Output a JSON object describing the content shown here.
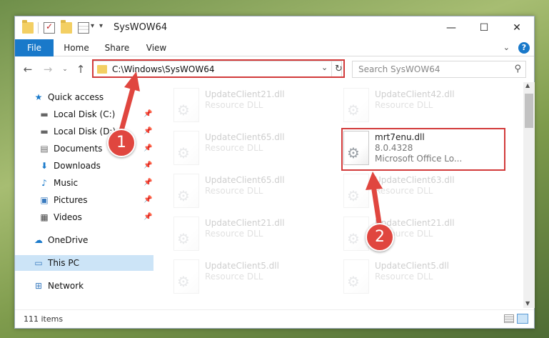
{
  "window": {
    "title": "SysWOW64",
    "controls": {
      "minimize": "—",
      "maximize": "☐",
      "close": "✕"
    }
  },
  "ribbon": {
    "tabs": [
      "File",
      "Home",
      "Share",
      "View"
    ],
    "help": "?"
  },
  "nav": {
    "address": "C:\\Windows\\SysWOW64",
    "search_placeholder": "Search SysWOW64"
  },
  "sidebar": {
    "items": [
      {
        "label": "Quick access",
        "icon": "star-icon",
        "pinned": false
      },
      {
        "label": "Local Disk (C:)",
        "icon": "drive-icon",
        "pinned": true
      },
      {
        "label": "Local Disk (D:)",
        "icon": "drive-icon",
        "pinned": true
      },
      {
        "label": "Documents",
        "icon": "documents-icon",
        "pinned": true
      },
      {
        "label": "Downloads",
        "icon": "download-icon",
        "pinned": true
      },
      {
        "label": "Music",
        "icon": "music-icon",
        "pinned": true
      },
      {
        "label": "Pictures",
        "icon": "pictures-icon",
        "pinned": true
      },
      {
        "label": "Videos",
        "icon": "videos-icon",
        "pinned": true
      },
      {
        "label": "OneDrive",
        "icon": "cloud-icon",
        "pinned": false
      },
      {
        "label": "This PC",
        "icon": "computer-icon",
        "pinned": false,
        "selected": true
      },
      {
        "label": "Network",
        "icon": "network-icon",
        "pinned": false
      }
    ]
  },
  "files": [
    {
      "name": "UpdateClient21.dll",
      "type": "Resource DLL",
      "desc": ""
    },
    {
      "name": "UpdateClient42.dll",
      "type": "Resource DLL",
      "desc": ""
    },
    {
      "name": "UpdateClient65.dll",
      "type": "Resource DLL",
      "desc": ""
    },
    {
      "name": "mrt7enu.dll",
      "type": "8.0.4328",
      "desc": "Microsoft Office Lo...",
      "highlighted": true
    },
    {
      "name": "UpdateClient65.dll",
      "type": "Resource DLL",
      "desc": ""
    },
    {
      "name": "UpdateClient63.dll",
      "type": "Resource DLL",
      "desc": ""
    },
    {
      "name": "UpdateClient21.dll",
      "type": "Resource DLL",
      "desc": ""
    },
    {
      "name": "UpdateClient21.dll",
      "type": "Resource DLL",
      "desc": ""
    },
    {
      "name": "UpdateClient5.dll",
      "type": "Resource DLL",
      "desc": ""
    },
    {
      "name": "UpdateClient5.dll",
      "type": "Resource DLL",
      "desc": ""
    }
  ],
  "status": {
    "item_count": "111 items"
  },
  "callouts": [
    "1",
    "2"
  ],
  "colors": {
    "accent": "#1979ca",
    "highlight": "#d23a3a",
    "selected": "#cce4f7"
  }
}
